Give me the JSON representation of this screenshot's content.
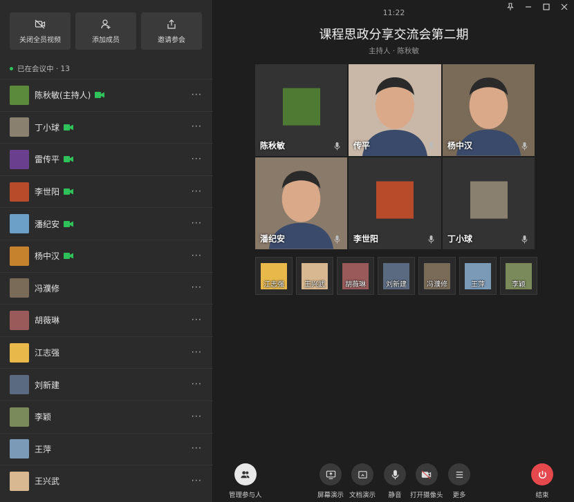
{
  "sidebar": {
    "actions": [
      {
        "label": "关闭全员视频",
        "icon": "camera-off-icon"
      },
      {
        "label": "添加成员",
        "icon": "add-user-icon"
      },
      {
        "label": "邀请参会",
        "icon": "share-icon"
      }
    ],
    "status": "已在会议中 · 13",
    "participants": [
      {
        "name": "陈秋敏(主持人)",
        "camera": true,
        "color": "#5a8a3a"
      },
      {
        "name": "丁小球",
        "camera": true,
        "color": "#8a8070"
      },
      {
        "name": "雷传平",
        "camera": true,
        "color": "#6a3f8e"
      },
      {
        "name": "李世阳",
        "camera": true,
        "color": "#b84c2a"
      },
      {
        "name": "潘纪安",
        "camera": true,
        "color": "#6ca0c8"
      },
      {
        "name": "杨中汉",
        "camera": true,
        "color": "#c7822e"
      },
      {
        "name": "冯濮修",
        "camera": false,
        "color": "#7a6a58"
      },
      {
        "name": "胡薇琳",
        "camera": false,
        "color": "#9a5a5a"
      },
      {
        "name": "江志强",
        "camera": false,
        "color": "#e8b84a"
      },
      {
        "name": "刘新建",
        "camera": false,
        "color": "#5a6a80"
      },
      {
        "name": "李颖",
        "camera": false,
        "color": "#7a8a5a"
      },
      {
        "name": "王萍",
        "camera": false,
        "color": "#7a9ab8"
      },
      {
        "name": "王兴武",
        "camera": false,
        "color": "#d8b890"
      }
    ]
  },
  "main": {
    "time": "11:22",
    "title": "课程思政分享交流会第二期",
    "host": "主持人 · 陈秋敏",
    "tiles": [
      {
        "name": "陈秋敏",
        "bg": "#333333",
        "thumb": "#4e7a34"
      },
      {
        "name": "传平",
        "bg": "#c9b8a8",
        "thumb": ""
      },
      {
        "name": "杨中汉",
        "bg": "#7a6a58",
        "thumb": ""
      },
      {
        "name": "潘纪安",
        "bg": "#8a7a6a",
        "thumb": ""
      },
      {
        "name": "李世阳",
        "bg": "#333333",
        "thumb": "#b84c2a"
      },
      {
        "name": "丁小球",
        "bg": "#333333",
        "thumb": "#8a8070"
      }
    ],
    "strip": [
      {
        "name": "江志强",
        "color": "#e8b84a"
      },
      {
        "name": "王兴武",
        "color": "#d8b890"
      },
      {
        "name": "胡薇琳",
        "color": "#9a5a5a"
      },
      {
        "name": "刘新建",
        "color": "#5a6a80"
      },
      {
        "name": "冯濮修",
        "color": "#7a6a58"
      },
      {
        "name": "王萍",
        "color": "#7a9ab8"
      },
      {
        "name": "李颖",
        "color": "#7a8a5a"
      }
    ]
  },
  "toolbar": {
    "manage": "管理参与人",
    "screen": "屏幕演示",
    "doc": "文档演示",
    "mute": "静音",
    "camera": "打开摄像头",
    "more": "更多",
    "end": "结束"
  },
  "colors": {
    "camera_on": "#2fc25b",
    "end": "#e5484d"
  }
}
